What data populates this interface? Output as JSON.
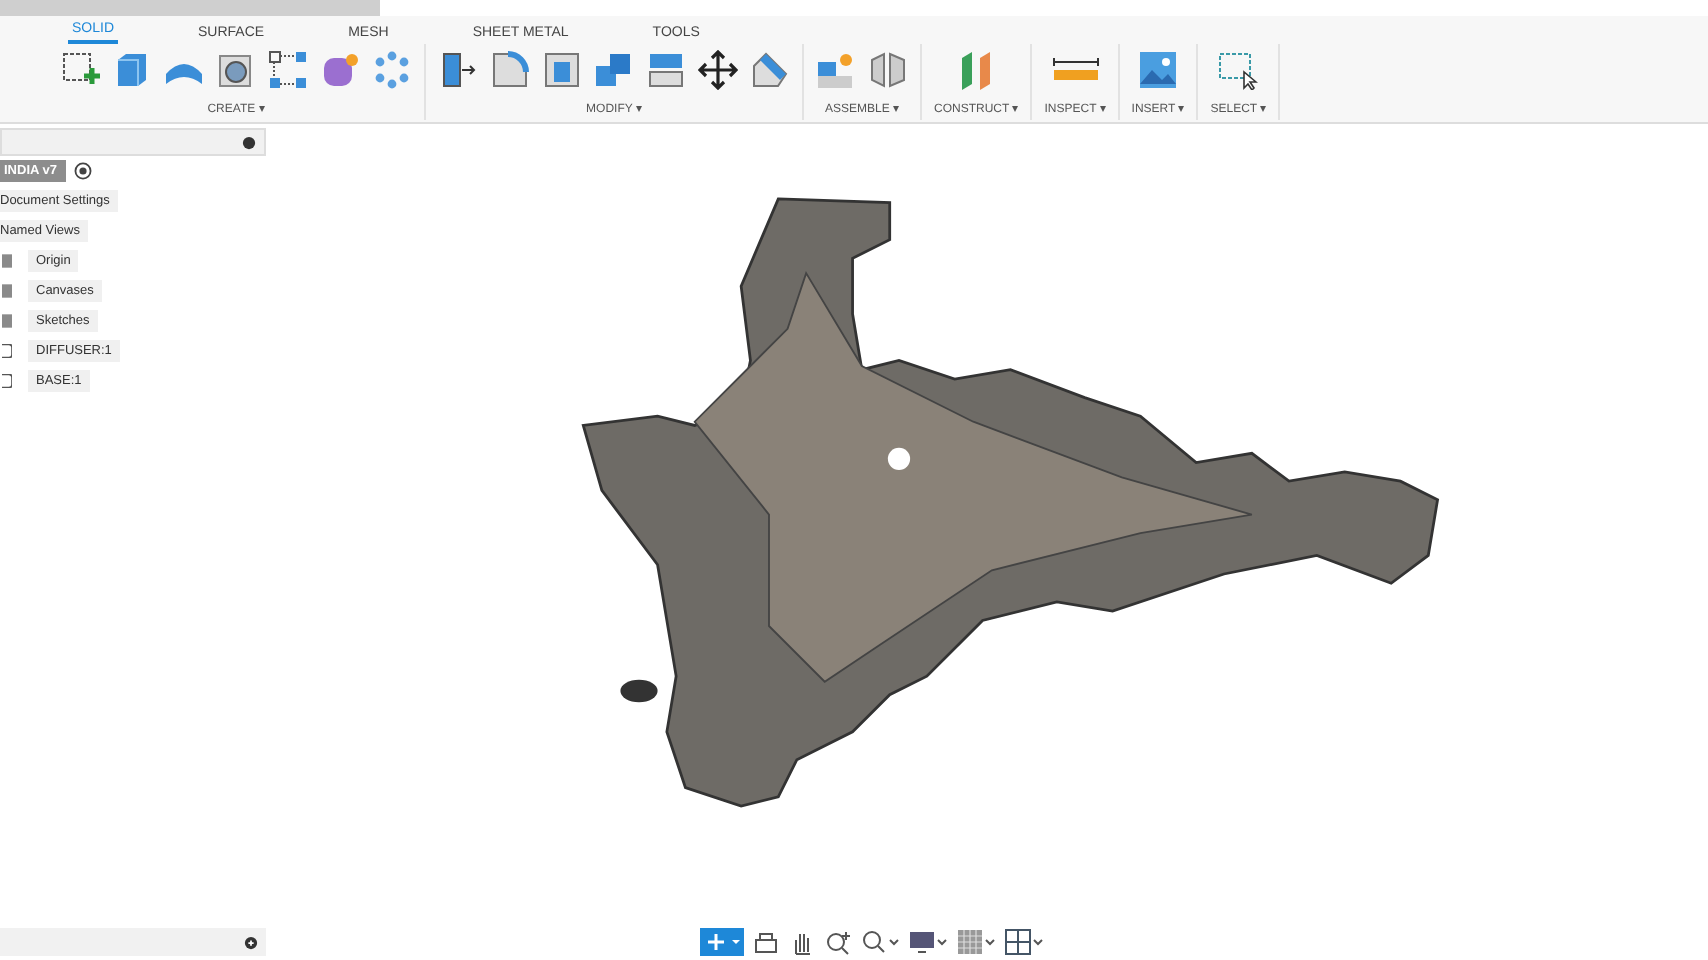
{
  "tabs": [
    {
      "label": "SOLID",
      "selected": true
    },
    {
      "label": "SURFACE",
      "selected": false
    },
    {
      "label": "MESH",
      "selected": false
    },
    {
      "label": "SHEET METAL",
      "selected": false
    },
    {
      "label": "TOOLS",
      "selected": false
    }
  ],
  "groups": [
    {
      "label": "CREATE ▾"
    },
    {
      "label": "MODIFY ▾"
    },
    {
      "label": "ASSEMBLE ▾"
    },
    {
      "label": "CONSTRUCT ▾"
    },
    {
      "label": "INSPECT ▾"
    },
    {
      "label": "INSERT ▾"
    },
    {
      "label": "SELECT ▾"
    }
  ],
  "browser": {
    "root": "INDIA v7",
    "items": [
      {
        "label": "Document Settings",
        "kind": "setting"
      },
      {
        "label": "Named Views",
        "kind": "setting"
      },
      {
        "label": "Origin",
        "kind": "folder"
      },
      {
        "label": "Canvases",
        "kind": "folder"
      },
      {
        "label": "Sketches",
        "kind": "folder"
      },
      {
        "label": "DIFFUSER:1",
        "kind": "body"
      },
      {
        "label": "BASE:1",
        "kind": "body"
      }
    ]
  }
}
